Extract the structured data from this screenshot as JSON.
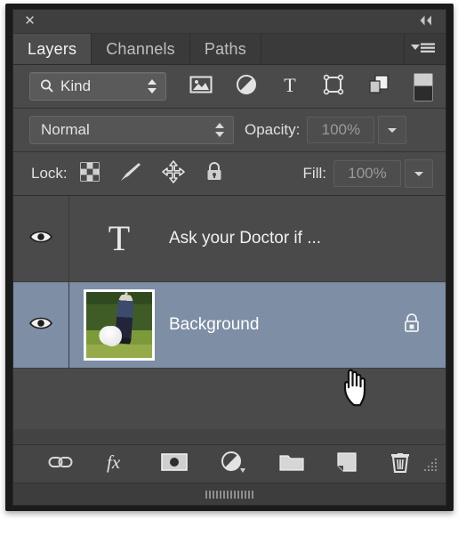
{
  "window": {
    "close_label": "✕",
    "collapse_icon": "double-chevron-left"
  },
  "tabs": [
    {
      "label": "Layers",
      "active": true
    },
    {
      "label": "Channels",
      "active": false
    },
    {
      "label": "Paths",
      "active": false
    }
  ],
  "panel_menu": {
    "icon": "panel-menu-icon"
  },
  "filter_row": {
    "kind_label": "Kind",
    "search_icon": "magnifier-icon",
    "stepper_icon": "up-down-stepper-icon",
    "type_filters": [
      {
        "name": "filter-pixel-layers",
        "icon": "image-icon"
      },
      {
        "name": "filter-adjustment-layers",
        "icon": "adjustment-circle-icon"
      },
      {
        "name": "filter-type-layers",
        "icon": "type-t-icon"
      },
      {
        "name": "filter-shape-layers",
        "icon": "shape-icon"
      },
      {
        "name": "filter-smart-objects",
        "icon": "smart-object-icon"
      }
    ],
    "toggle_name": "filter-enable-toggle"
  },
  "blend_row": {
    "blend_mode": "Normal",
    "opacity_label": "Opacity:",
    "opacity_value": "100%"
  },
  "lock_row": {
    "lock_label": "Lock:",
    "lock_icons": [
      {
        "name": "lock-transparent-pixels",
        "icon": "checkerboard-icon"
      },
      {
        "name": "lock-image-pixels",
        "icon": "paintbrush-icon"
      },
      {
        "name": "lock-position",
        "icon": "move-arrows-icon"
      },
      {
        "name": "lock-all",
        "icon": "padlock-icon"
      }
    ],
    "fill_label": "Fill:",
    "fill_value": "100%"
  },
  "layers": [
    {
      "name": "Ask your Doctor if ...",
      "thumb_type": "type",
      "thumb_glyph": "T",
      "visible": true,
      "selected": false,
      "locked": false
    },
    {
      "name": "Background",
      "thumb_type": "photo",
      "thumb_description": "golfer-swinging-photo",
      "visible": true,
      "selected": true,
      "locked": true
    }
  ],
  "cursor": {
    "type": "hand-pointer-cursor"
  },
  "bottom_toolbar": [
    {
      "name": "link-layers-button",
      "icon": "link-chain-icon"
    },
    {
      "name": "layer-styles-button",
      "icon": "fx-icon"
    },
    {
      "name": "add-layer-mask-button",
      "icon": "mask-icon"
    },
    {
      "name": "new-adjustment-layer-button",
      "icon": "adjustment-circle-icon"
    },
    {
      "name": "new-group-button",
      "icon": "folder-icon"
    },
    {
      "name": "new-layer-button",
      "icon": "new-page-icon"
    },
    {
      "name": "delete-layer-button",
      "icon": "trash-icon"
    }
  ],
  "colors": {
    "panel_bg": "#4a4a4a",
    "tab_active_bg": "#4c4c4c",
    "selected_layer_bg": "#7d8ea5",
    "text": "#e8e8e8"
  }
}
